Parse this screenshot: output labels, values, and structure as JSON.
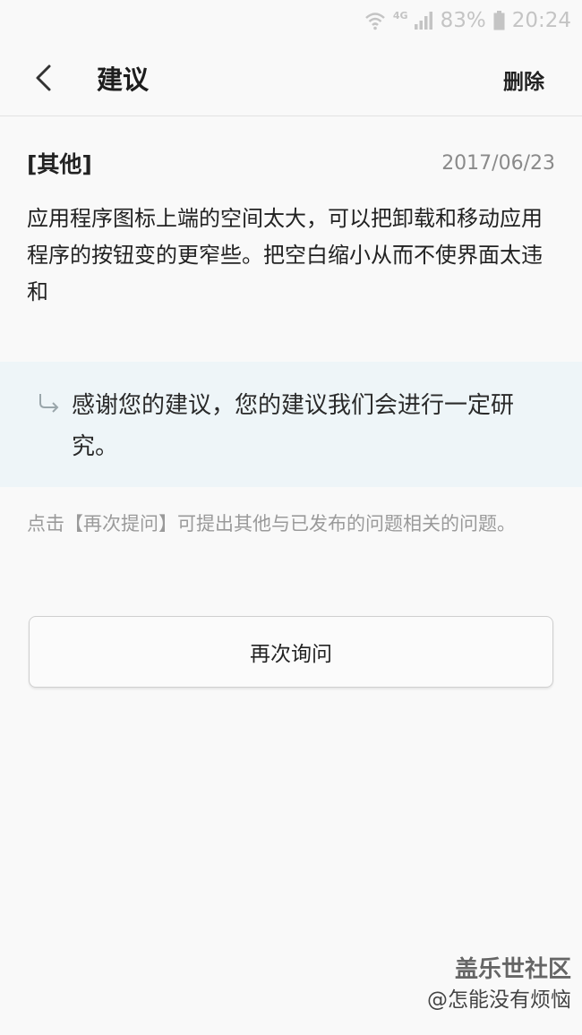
{
  "status_bar": {
    "network_type": "4G",
    "battery": "83%",
    "time": "20:24",
    "icons": [
      "wifi-icon",
      "signal-icon",
      "battery-icon"
    ]
  },
  "app_bar": {
    "title": "建议",
    "delete_label": "删除",
    "back_icon": "back-arrow-icon"
  },
  "question": {
    "category": "[其他]",
    "date": "2017/06/23",
    "body": "应用程序图标上端的空间太大，可以把卸载和移动应用程序的按钮变的更窄些。把空白缩小从而不使界面太违和"
  },
  "reply": {
    "icon": "reply-arrow-icon",
    "text": "感谢您的建议，您的建议我们会进行一定研究。"
  },
  "hint": "点击【再次提问】可提出其他与已发布的问题相关的问题。",
  "ask_again_label": "再次询问",
  "watermark": {
    "title": "盖乐世社区",
    "user": "@怎能没有烦恼"
  },
  "colors": {
    "background": "#f9f9f9",
    "reply_background": "#eef5f8",
    "muted_text": "#9a9a9a",
    "status_text": "#c4c4c4"
  }
}
